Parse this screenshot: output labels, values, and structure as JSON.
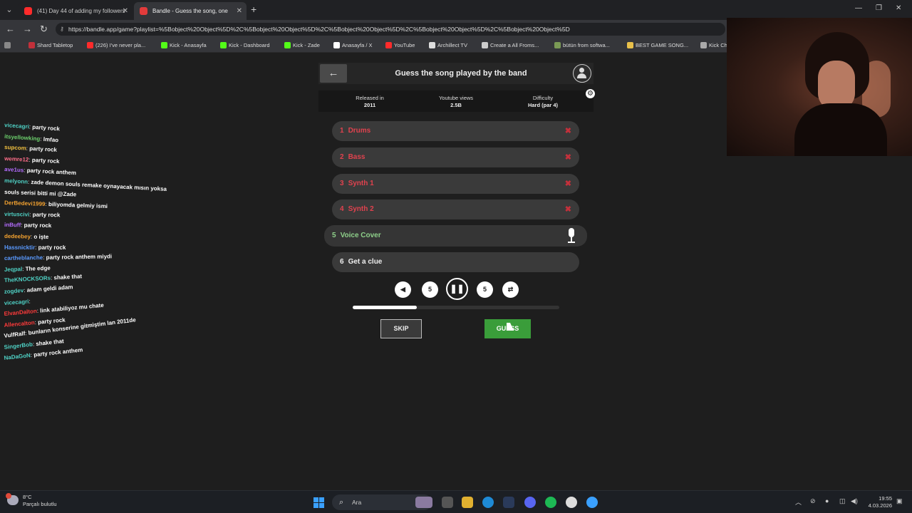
{
  "browser": {
    "tabs": [
      {
        "label": "(41) Day 44 of adding my followers",
        "favicon_color": "#ff2b2b",
        "active": false
      },
      {
        "label": "Bandle - Guess the song, one",
        "favicon_color": "#e23b3b",
        "active": true
      }
    ],
    "url": "https://bandle.app/game?playlist=%5Bobject%20Object%5D%2C%5Bobject%20Object%5D%2C%5Bobject%20Object%5D%2C%5Bobject%20Object%5D%2C%5Bobject%20Object%5D",
    "bookmarks": [
      {
        "label": "Shard Tabletop",
        "color": "#c2303a"
      },
      {
        "label": "(226) I've never pla...",
        "color": "#ff2b2b"
      },
      {
        "label": "Kick - Anasayfa",
        "color": "#53fc18"
      },
      {
        "label": "Kick - Dashboard",
        "color": "#53fc18"
      },
      {
        "label": "Kick - Zade",
        "color": "#53fc18"
      },
      {
        "label": "Anasayfa / X",
        "color": "#ffffff"
      },
      {
        "label": "YouTube",
        "color": "#ff2b2b"
      },
      {
        "label": "Archillect TV",
        "color": "#dddddd"
      },
      {
        "label": "Create a All Froms...",
        "color": "#cccccc"
      },
      {
        "label": "bütün from softwa...",
        "color": "#7a9a55"
      },
      {
        "label": "BEST GAME SONG...",
        "color": "#e8c04a"
      },
      {
        "label": "Kick Ch",
        "color": "#aaaaaa"
      }
    ]
  },
  "chat": [
    {
      "user": "vicecagri",
      "color": "#4fd1c5",
      "msg": "party rock",
      "rot": 4
    },
    {
      "user": "itsyellowking",
      "color": "#6ccf6c",
      "msg": "lmfao",
      "rot": 4
    },
    {
      "user": "supcom",
      "color": "#f0c040",
      "msg": "party rock",
      "rot": 3
    },
    {
      "user": "wemre12",
      "color": "#ff6e8a",
      "msg": "party rock",
      "rot": 3
    },
    {
      "user": "ave1us",
      "color": "#b46cff",
      "msg": "party rock anthem",
      "rot": 3
    },
    {
      "user": "melyonn",
      "color": "#4fd1c5",
      "msg": "zade demon souls remake oynayacak mısın yoksa",
      "rot": 3
    },
    {
      "user": "",
      "color": "#ffffff",
      "msg": "souls serisi bitti mi @Zade",
      "rot": 2
    },
    {
      "user": "DerBedevi1999",
      "color": "#f0a030",
      "msg": "biliyomda gelmiy ismi",
      "rot": 2
    },
    {
      "user": "virtuscivi",
      "color": "#4fd1c5",
      "msg": "party rock",
      "rot": 1
    },
    {
      "user": "inBuff",
      "color": "#b46cff",
      "msg": "party rock",
      "rot": 1
    },
    {
      "user": "dedeebey",
      "color": "#f0a030",
      "msg": "o işte",
      "rot": 1
    },
    {
      "user": "Hassnicktir",
      "color": "#5a9aff",
      "msg": "party rock",
      "rot": 0
    },
    {
      "user": "cartheblanche",
      "color": "#5a9aff",
      "msg": "party rock anthem miydi",
      "rot": -1
    },
    {
      "user": "Jeqpal",
      "color": "#4fd1c5",
      "msg": "The edge",
      "rot": -2
    },
    {
      "user": "TheKNOCKSORs",
      "color": "#4fd1c5",
      "msg": "shake that",
      "rot": -3
    },
    {
      "user": "zogdev",
      "color": "#4fd1c5",
      "msg": "adam geldi adam",
      "rot": -4
    },
    {
      "user": "vicecagri",
      "color": "#4fd1c5",
      "msg": "",
      "rot": -4
    },
    {
      "user": "ElvanDalton",
      "color": "#ff3b3b",
      "msg": "link atabiliyoz mu chate",
      "rot": -5
    },
    {
      "user": "Allencalton",
      "color": "#ff3b3b",
      "msg": "party rock",
      "rot": -5
    },
    {
      "user": "VulfRalf",
      "color": "#ffffff",
      "msg": "bunların konserine gitmiştim lan 2011de",
      "rot": -7
    },
    {
      "user": "SingerBob",
      "color": "#4fd1c5",
      "msg": "shake that",
      "rot": -6
    },
    {
      "user": "NaDaGoN",
      "color": "#4fd1c5",
      "msg": "party rock anthem",
      "rot": -6
    }
  ],
  "game": {
    "title": "Guess the song played by the band",
    "info": [
      {
        "label": "Released in",
        "value": "2011"
      },
      {
        "label": "Youtube views",
        "value": "2.5B"
      },
      {
        "label": "Difficulty",
        "value": "Hard (par 4)"
      }
    ],
    "rows": [
      {
        "num": "1",
        "label": "Drums"
      },
      {
        "num": "2",
        "label": "Bass"
      },
      {
        "num": "3",
        "label": "Synth 1"
      },
      {
        "num": "4",
        "label": "Synth 2"
      }
    ],
    "active_row": {
      "num": "5",
      "label": "Voice Cover"
    },
    "clue_row": {
      "num": "6",
      "label": "Get a clue"
    },
    "rewind_label": "5",
    "forward_label": "5",
    "progress_fraction": 0.31,
    "skip_label": "SKIP",
    "guess_label": "GUESS"
  },
  "taskbar": {
    "temp": "8°C",
    "weather": "Parçalı bulutlu",
    "search": "Ara",
    "time": "19:55",
    "date": "4.03.2026"
  },
  "colors": {
    "accent_green": "#3a9d3a",
    "wrong_red": "#e0424e",
    "active_green_text": "#8ed08a"
  }
}
